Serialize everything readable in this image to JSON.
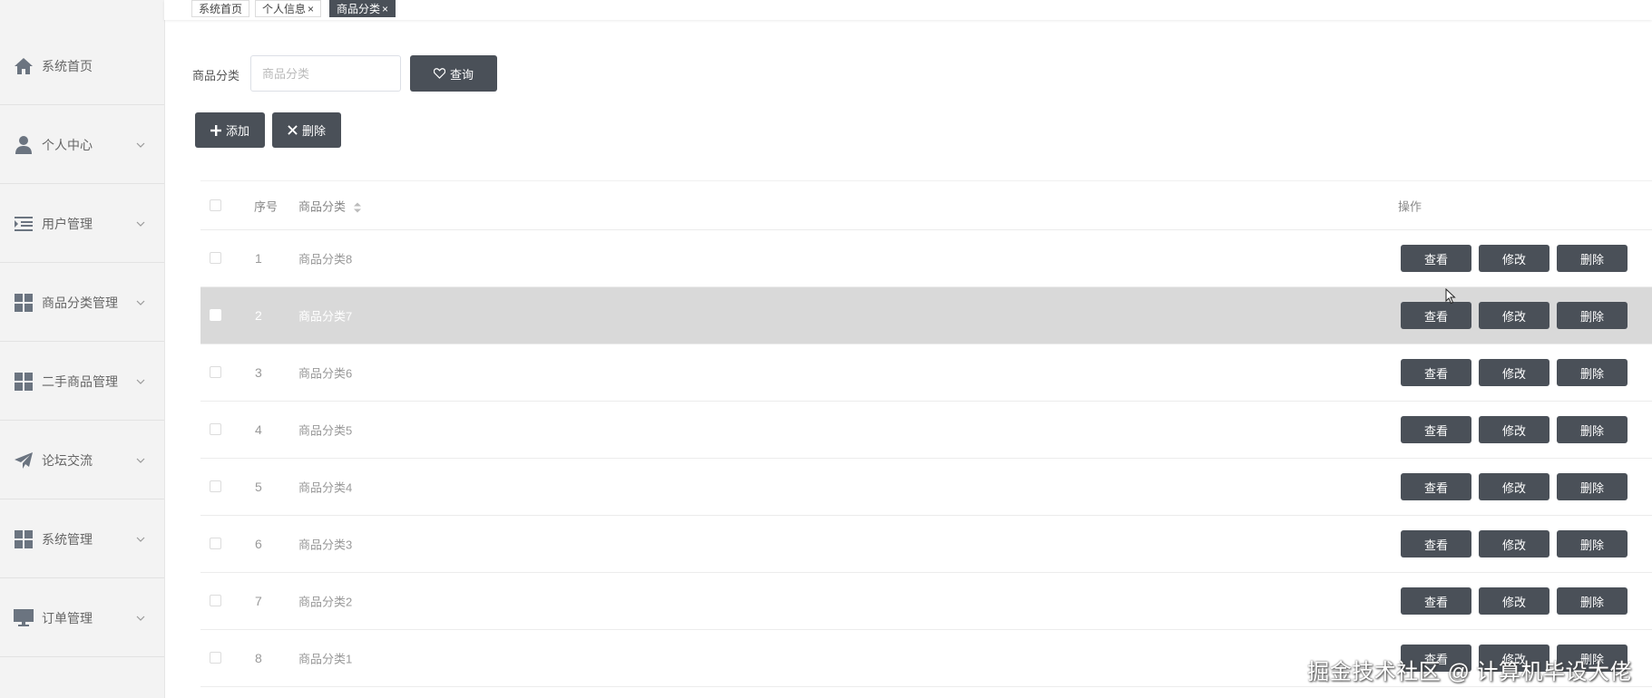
{
  "sidebar": {
    "items": [
      {
        "label": "系统首页",
        "icon": "home-icon",
        "has_arrow": false
      },
      {
        "label": "个人中心",
        "icon": "user-icon",
        "has_arrow": true
      },
      {
        "label": "用户管理",
        "icon": "indent-icon",
        "has_arrow": true
      },
      {
        "label": "商品分类管理",
        "icon": "grid-icon",
        "has_arrow": true
      },
      {
        "label": "二手商品管理",
        "icon": "grid-icon",
        "has_arrow": true
      },
      {
        "label": "论坛交流",
        "icon": "paper-plane-icon",
        "has_arrow": true
      },
      {
        "label": "系统管理",
        "icon": "grid-icon",
        "has_arrow": true
      },
      {
        "label": "订单管理",
        "icon": "monitor-icon",
        "has_arrow": true
      }
    ]
  },
  "tabs": [
    {
      "label": "系统首页",
      "closable": false,
      "active": false
    },
    {
      "label": "个人信息",
      "closable": true,
      "active": false
    },
    {
      "label": "商品分类",
      "closable": true,
      "active": true
    }
  ],
  "tab_close_glyph": "×",
  "search": {
    "label": "商品分类",
    "placeholder": "商品分类",
    "value": "",
    "button_label": "查询"
  },
  "toolbar": {
    "add_label": "添加",
    "delete_label": "删除"
  },
  "table": {
    "headers": {
      "index": "序号",
      "name": "商品分类",
      "actions": "操作"
    },
    "rows": [
      {
        "index": "1",
        "name": "商品分类8"
      },
      {
        "index": "2",
        "name": "商品分类7",
        "highlighted": true
      },
      {
        "index": "3",
        "name": "商品分类6"
      },
      {
        "index": "4",
        "name": "商品分类5"
      },
      {
        "index": "5",
        "name": "商品分类4"
      },
      {
        "index": "6",
        "name": "商品分类3"
      },
      {
        "index": "7",
        "name": "商品分类2"
      },
      {
        "index": "8",
        "name": "商品分类1"
      }
    ],
    "actions": {
      "view": "查看",
      "edit": "修改",
      "delete": "删除"
    }
  },
  "watermark": "掘金技术社区 @ 计算机毕设大佬",
  "colors": {
    "dark_button": "#4a5058",
    "sidebar_bg": "#f3f3f3",
    "highlight_row": "#d9d9d9",
    "icon": "#6b7480"
  }
}
